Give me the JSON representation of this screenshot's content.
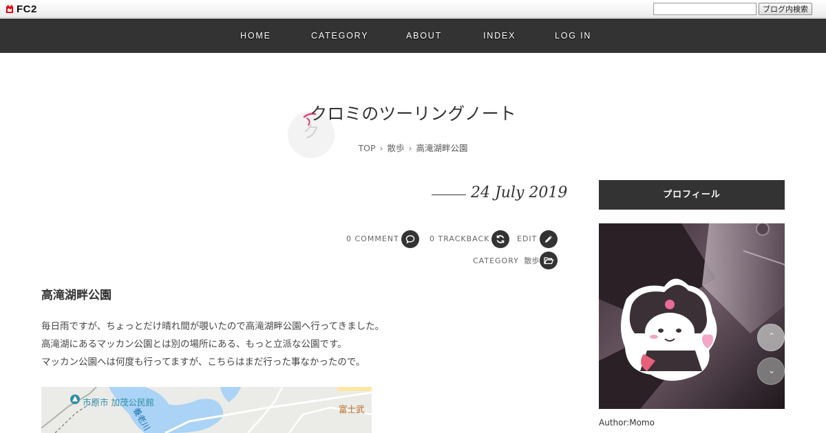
{
  "fc2": {
    "logo_text": "FC2",
    "search_placeholder": "",
    "search_button": "ブログ内検索"
  },
  "nav": {
    "items": [
      {
        "label": "HOME"
      },
      {
        "label": "CATEGORY"
      },
      {
        "label": "ABOUT"
      },
      {
        "label": "INDEX"
      },
      {
        "label": "LOG IN"
      }
    ]
  },
  "blog": {
    "title": "クロミのツーリングノート",
    "title_decoration_char": "ク"
  },
  "breadcrumb": {
    "top": "TOP",
    "category": "散歩",
    "current": "高滝湖畔公園",
    "separator": "›"
  },
  "entry": {
    "date": "24 July 2019",
    "comment_label": "0 COMMENT",
    "trackback_label": "0 TRACKBACK",
    "edit_label": "EDIT",
    "category_label": "CATEGORY",
    "category_value": "散歩",
    "title": "高滝湖畔公園",
    "paragraphs": [
      "毎日雨ですが、ちょっとだけ晴れ間が覗いたので高滝湖畔公園へ行ってきました。",
      "高滝湖にあるマッカン公園とは別の場所にある、もっと立派な公園です。",
      "マッカン公園へは何度も行ってますが、こちらはまだ行った事なかったので。"
    ]
  },
  "map": {
    "place_label": "市原市 加茂公民館",
    "river_label": "養老川",
    "right_label": "富士武",
    "place_color": "#2f8fa6",
    "river_color": "#1a6fb0",
    "right_color": "#b5651d"
  },
  "sidebar": {
    "profile_heading": "プロフィール",
    "author": "Author:Momo"
  },
  "colors": {
    "nav_bg": "#333333",
    "accent_pink": "#e0407a",
    "circle_bg": "#333333"
  }
}
